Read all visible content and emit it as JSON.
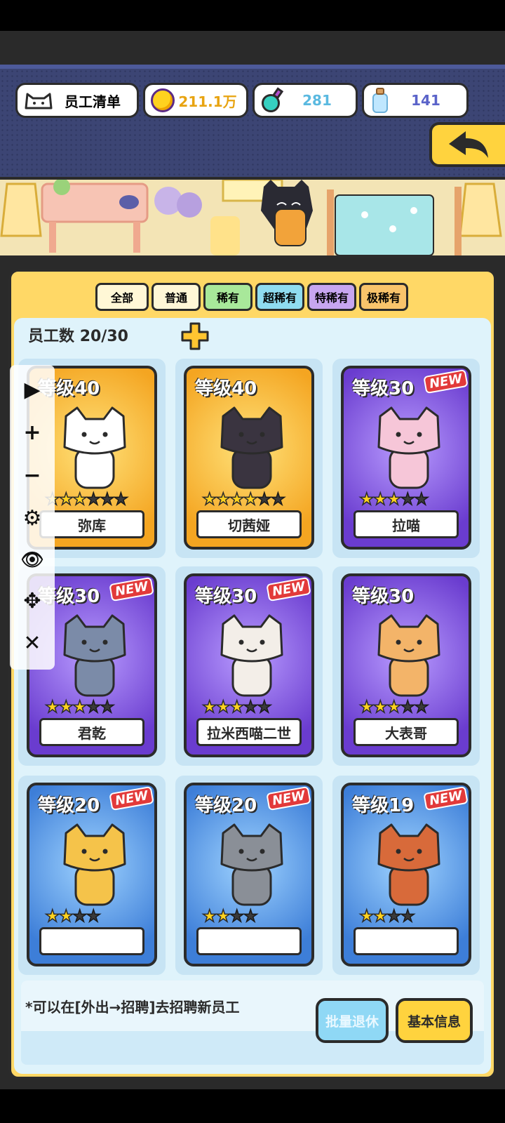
{
  "header": {
    "title": "员工清单",
    "coins": "211.1万",
    "potions": "281",
    "bottles": "141"
  },
  "filters": [
    {
      "label": "全部",
      "color": "#fff7d6"
    },
    {
      "label": "普通",
      "color": "#fff7d6"
    },
    {
      "label": "稀有",
      "color": "#a8e89a"
    },
    {
      "label": "超稀有",
      "color": "#8fdcf0"
    },
    {
      "label": "特稀有",
      "color": "#c7a6f0"
    },
    {
      "label": "极稀有",
      "color": "#f9c46b"
    }
  ],
  "staff": {
    "label": "员工数",
    "count": "20/30"
  },
  "cards": [
    {
      "level": "等级40",
      "name": "弥库",
      "rarity": "gold",
      "new": false,
      "stars": 3,
      "max_stars": 6
    },
    {
      "level": "等级40",
      "name": "切茜娅",
      "rarity": "gold",
      "new": false,
      "stars": 4,
      "max_stars": 6
    },
    {
      "level": "等级30",
      "name": "拉喵",
      "rarity": "purple",
      "new": true,
      "stars": 3,
      "max_stars": 5
    },
    {
      "level": "等级30",
      "name": "君乾",
      "rarity": "purple",
      "new": true,
      "stars": 3,
      "max_stars": 5
    },
    {
      "level": "等级30",
      "name": "拉米西喵二世",
      "rarity": "purple",
      "new": true,
      "stars": 3,
      "max_stars": 5
    },
    {
      "level": "等级30",
      "name": "大表哥",
      "rarity": "purple",
      "new": false,
      "stars": 3,
      "max_stars": 5
    },
    {
      "level": "等级20",
      "name": "",
      "rarity": "blue",
      "new": true,
      "stars": 2,
      "max_stars": 4
    },
    {
      "level": "等级20",
      "name": "",
      "rarity": "blue",
      "new": true,
      "stars": 2,
      "max_stars": 4
    },
    {
      "level": "等级19",
      "name": "",
      "rarity": "blue",
      "new": true,
      "stars": 2,
      "max_stars": 4
    }
  ],
  "new_label": "NEW",
  "hint": "*可以在[外出→招聘]去招聘新员工",
  "buttons": {
    "retire": "批量退休",
    "info": "基本信息"
  },
  "toolbar": {
    "play": "▶",
    "zoom_in": "+",
    "zoom_out": "−",
    "settings": "⚙",
    "view": "👁",
    "move": "✥",
    "close": "✕"
  }
}
